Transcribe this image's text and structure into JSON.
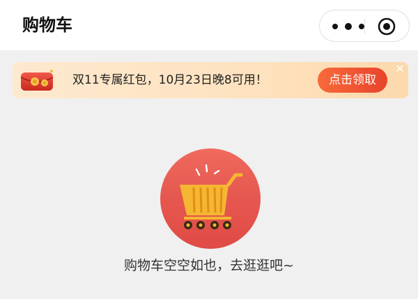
{
  "header": {
    "title": "购物车",
    "more_icon": "more-dots-icon",
    "close_icon": "target-close-icon"
  },
  "banner": {
    "icon": "red-envelope-icon",
    "text": "双11专属红包，10月23日晚8可用！",
    "button_label": "点击领取",
    "close_label": "✕",
    "accent_color": "#e8442c",
    "background_color": "#fde9cf"
  },
  "empty_state": {
    "icon": "shopping-cart-icon",
    "message": "购物车空空如也，去逛逛吧~",
    "circle_color": "#e55a52"
  }
}
